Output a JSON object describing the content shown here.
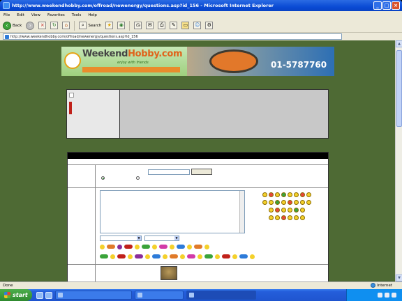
{
  "window": {
    "title": "http://www.weekendhobby.com/offroad/newenergy/questions.asp?id_156 - Microsoft Internet Explorer",
    "minimize": "_",
    "maximize": "□",
    "close": "×"
  },
  "menu": [
    "File",
    "Edit",
    "View",
    "Favorites",
    "Tools",
    "Help"
  ],
  "toolbar": {
    "back_label": "Back",
    "search_label": "Search"
  },
  "address": {
    "url": "http://www.weekendhobby.com/offroad/newenergy/questions.asp?id_156"
  },
  "banner": {
    "logo_prefix": "Weekend",
    "logo_suffix": "Hobby.com",
    "tagline": "enjoy with friends",
    "caption": "",
    "ad_phone": "01-5787760"
  },
  "status": {
    "left": "Done",
    "zone": "Internet"
  },
  "taskbar": {
    "start": "start",
    "clock": "",
    "tasks": [
      {
        "label": "",
        "active": false
      },
      {
        "label": "",
        "active": false
      },
      {
        "label": "",
        "active": true
      }
    ]
  },
  "colors": {
    "page_bg": "#4e6a34",
    "titlebar": "#0a4bd5",
    "taskbar": "#245edb",
    "start": "#2f8a2f"
  }
}
